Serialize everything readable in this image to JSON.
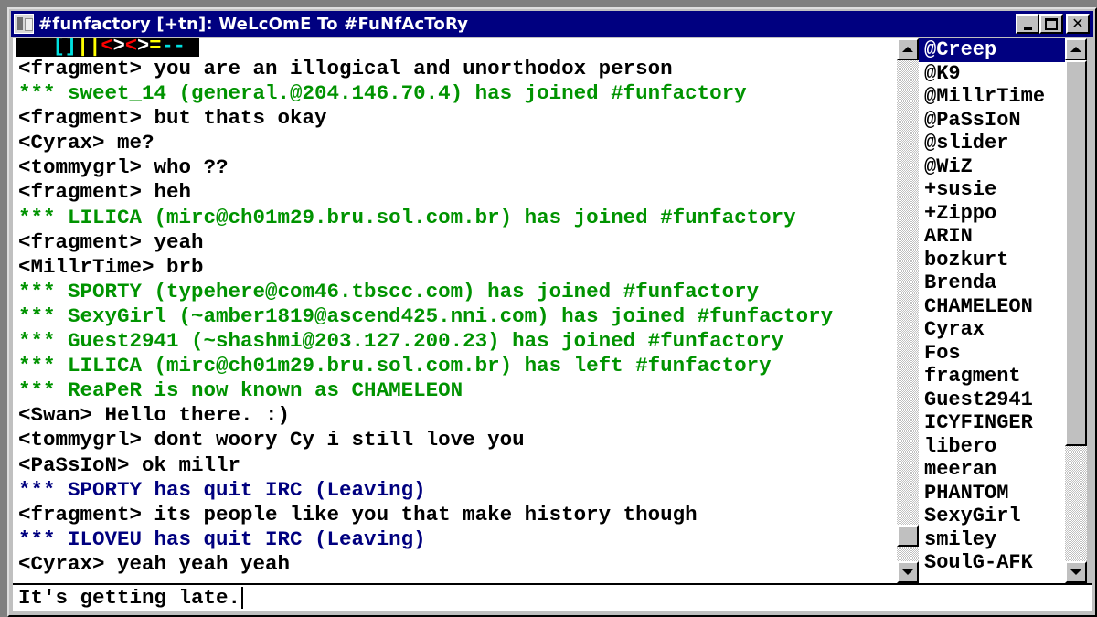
{
  "window": {
    "title": "#funfactory [+tn]: WeLcOmE To #FuNfAcToRy",
    "buttons": {
      "minimize": "minimize",
      "maximize": "maximize",
      "close": "✕"
    }
  },
  "banner": {
    "segments": [
      {
        "text": "   ",
        "color": "#000000"
      },
      {
        "text": "[]",
        "color": "#00e0e0"
      },
      {
        "text": "||",
        "color": "#ffff00"
      },
      {
        "text": "<",
        "color": "#ff0000"
      },
      {
        "text": ">",
        "color": "#ffffff"
      },
      {
        "text": "<",
        "color": "#ff0000"
      },
      {
        "text": ">",
        "color": "#ffffff"
      },
      {
        "text": "=",
        "color": "#ffff00"
      },
      {
        "text": "--",
        "color": "#00e0e0"
      }
    ]
  },
  "colors": {
    "title_bar": "#000080",
    "join_event": "#009300",
    "quit_event": "#00007f",
    "message": "#000000",
    "selected_nick_bg": "#000080"
  },
  "chat": {
    "lines": [
      {
        "type": "message",
        "text": "<fragment> you are an illogical and unorthodox person"
      },
      {
        "type": "join",
        "text": "*** sweet_14 (general.@204.146.70.4) has joined #funfactory"
      },
      {
        "type": "message",
        "text": "<fragment> but thats okay"
      },
      {
        "type": "message",
        "text": "<Cyrax> me?"
      },
      {
        "type": "message",
        "text": "<tommygrl> who ??"
      },
      {
        "type": "message",
        "text": "<fragment> heh"
      },
      {
        "type": "join",
        "text": "*** LILICA (mirc@ch01m29.bru.sol.com.br) has joined #funfactory"
      },
      {
        "type": "message",
        "text": "<fragment> yeah"
      },
      {
        "type": "message",
        "text": "<MillrTime> brb"
      },
      {
        "type": "join",
        "text": "*** SPORTY (typehere@com46.tbscc.com) has joined #funfactory"
      },
      {
        "type": "join",
        "text": "*** SexyGirl (~amber1819@ascend425.nni.com) has joined #funfactory"
      },
      {
        "type": "join",
        "text": "*** Guest2941 (~shashmi@203.127.200.23) has joined #funfactory"
      },
      {
        "type": "join",
        "text": "*** LILICA (mirc@ch01m29.bru.sol.com.br) has left #funfactory"
      },
      {
        "type": "join",
        "text": "*** ReaPeR is now known as CHAMELEON"
      },
      {
        "type": "message",
        "text": "<Swan> Hello there. :)"
      },
      {
        "type": "message",
        "text": "<tommygrl> dont woory Cy i still love you"
      },
      {
        "type": "message",
        "text": "<PaSsIoN> ok millr"
      },
      {
        "type": "quit",
        "text": "*** SPORTY has quit IRC (Leaving)"
      },
      {
        "type": "message",
        "text": "<fragment> its people like you that make history though"
      },
      {
        "type": "quit",
        "text": "*** ILOVEU has quit IRC (Leaving)"
      },
      {
        "type": "message",
        "text": "<Cyrax> yeah yeah yeah"
      }
    ],
    "scroll_position_fraction": 0.97
  },
  "nicklist": {
    "selected": "@Creep",
    "nicks": [
      "@Creep",
      "@K9",
      "@MillrTime",
      "@PaSsIoN",
      "@slider",
      "@WiZ",
      "+susie",
      "+Zippo",
      "ARIN",
      "bozkurt",
      "Brenda",
      "CHAMELEON",
      "Cyrax",
      "Fos",
      "fragment",
      "Guest2941",
      "ICYFINGER",
      "libero",
      "meeran",
      "PHANTOM",
      "SexyGirl",
      "smiley",
      "SoulG-AFK"
    ],
    "scroll_position_fraction": 0.0,
    "visible_fraction": 0.77
  },
  "input": {
    "value": "It's getting late."
  }
}
